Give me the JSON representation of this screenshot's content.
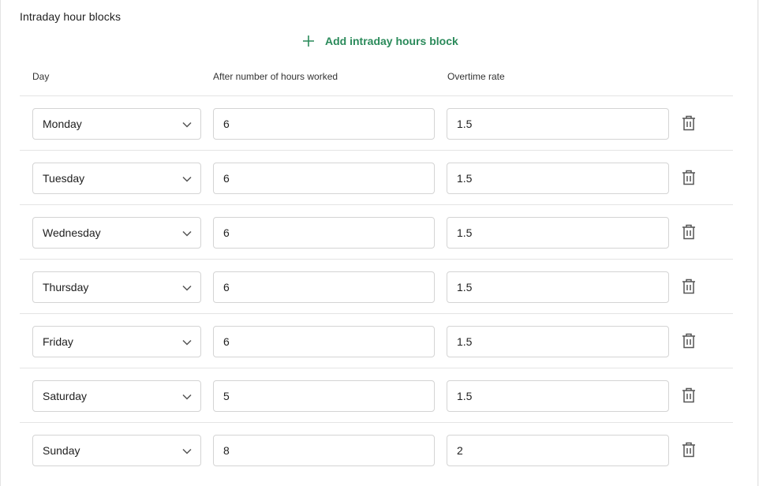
{
  "section": {
    "title": "Intraday hour blocks",
    "add_label": "Add intraday hours block"
  },
  "columns": {
    "day": "Day",
    "hours": "After number of hours worked",
    "rate": "Overtime rate"
  },
  "colors": {
    "accent": "#2a8a5a",
    "border": "#d4d4d4",
    "divider": "#e4e4e4",
    "icon": "#555555"
  },
  "icons": {
    "add": "plus-icon",
    "dropdown": "chevron-down-icon",
    "delete": "trash-icon"
  },
  "blocks": [
    {
      "day": "Monday",
      "hours": "6",
      "rate": "1.5"
    },
    {
      "day": "Tuesday",
      "hours": "6",
      "rate": "1.5"
    },
    {
      "day": "Wednesday",
      "hours": "6",
      "rate": "1.5"
    },
    {
      "day": "Thursday",
      "hours": "6",
      "rate": "1.5"
    },
    {
      "day": "Friday",
      "hours": "6",
      "rate": "1.5"
    },
    {
      "day": "Saturday",
      "hours": "5",
      "rate": "1.5"
    },
    {
      "day": "Sunday",
      "hours": "8",
      "rate": "2"
    }
  ]
}
